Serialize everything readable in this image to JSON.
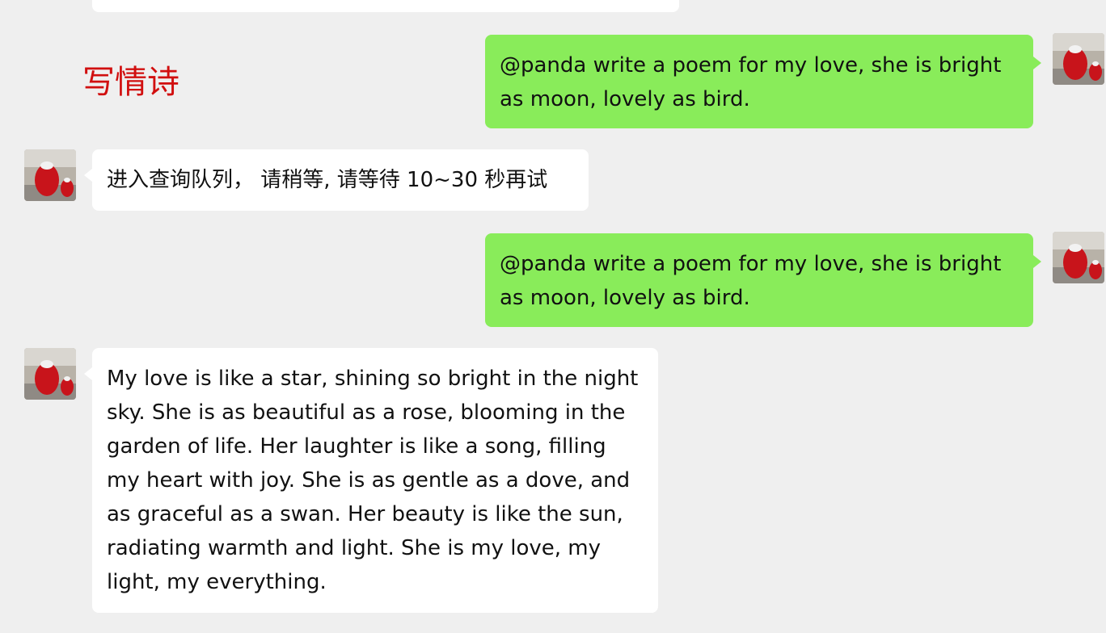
{
  "annotation": "写情诗",
  "messages": [
    {
      "side": "right",
      "text": "@panda write a poem for my love, she is bright as moon, lovely as bird."
    },
    {
      "side": "left",
      "text": "进入查询队列， 请稍等, 请等待 10~30 秒再试"
    },
    {
      "side": "right",
      "text": "@panda write a poem for my love, she is bright as moon, lovely as bird."
    },
    {
      "side": "left",
      "text": "My love is like a star, shining so bright in the night sky. She is as beautiful as a rose, blooming in the garden of life. Her laughter is like a song, filling my heart with joy. She is as gentle as a dove, and as graceful as a swan. Her beauty is like the sun, radiating warmth and light. She is my love, my light, my everything."
    }
  ],
  "colors": {
    "background": "#efefef",
    "incoming_bubble": "#ffffff",
    "outgoing_bubble": "#89ec5a",
    "annotation": "#d10f0f"
  },
  "icons": {
    "avatar": "avatar-icon"
  }
}
